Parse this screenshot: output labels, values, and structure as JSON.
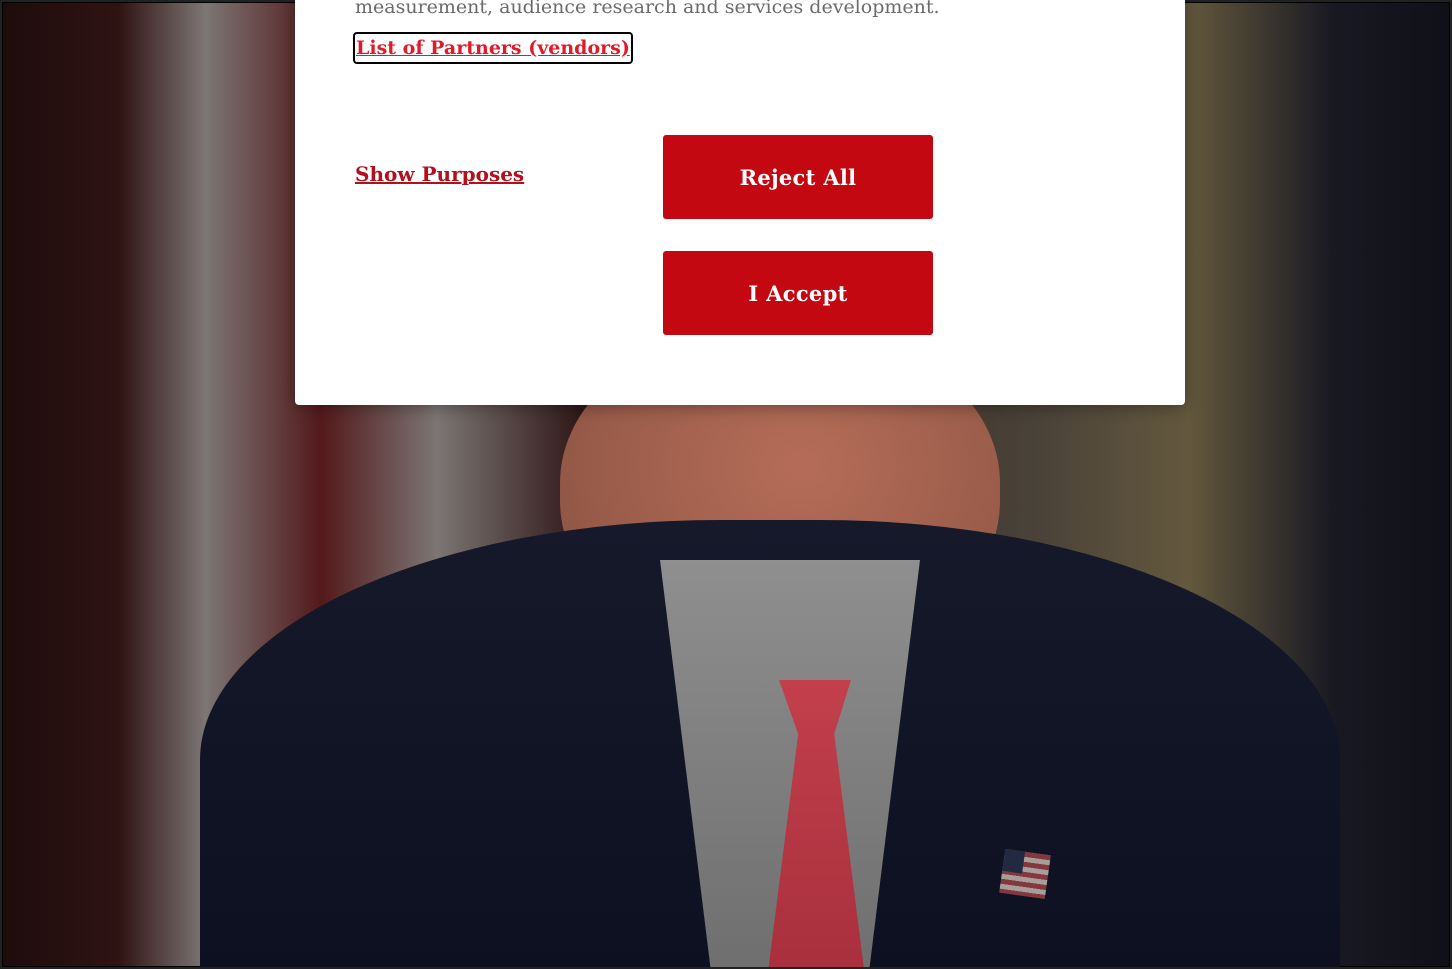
{
  "dialog": {
    "text_line": "measurement, audience research and services development.",
    "partners_link": "List of Partners (vendors)",
    "show_purposes": "Show Purposes",
    "reject_all": "Reject All",
    "accept": "I Accept"
  },
  "colors": {
    "accent_red": "#c40811",
    "link_red": "#e11a2a",
    "dialog_bg": "#ffffff"
  },
  "background": {
    "icon": "news-photo-backdrop"
  }
}
